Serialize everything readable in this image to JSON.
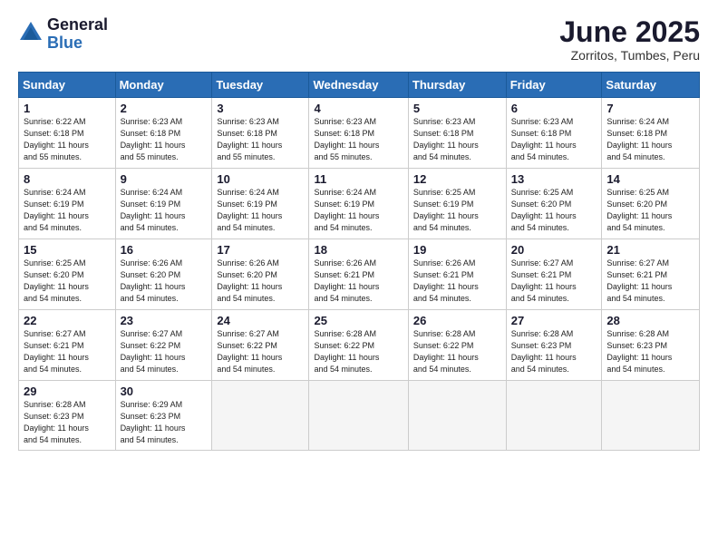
{
  "logo": {
    "general": "General",
    "blue": "Blue"
  },
  "header": {
    "month": "June 2025",
    "location": "Zorritos, Tumbes, Peru"
  },
  "weekdays": [
    "Sunday",
    "Monday",
    "Tuesday",
    "Wednesday",
    "Thursday",
    "Friday",
    "Saturday"
  ],
  "weeks": [
    [
      {
        "day": "1",
        "info": "Sunrise: 6:22 AM\nSunset: 6:18 PM\nDaylight: 11 hours\nand 55 minutes."
      },
      {
        "day": "2",
        "info": "Sunrise: 6:23 AM\nSunset: 6:18 PM\nDaylight: 11 hours\nand 55 minutes."
      },
      {
        "day": "3",
        "info": "Sunrise: 6:23 AM\nSunset: 6:18 PM\nDaylight: 11 hours\nand 55 minutes."
      },
      {
        "day": "4",
        "info": "Sunrise: 6:23 AM\nSunset: 6:18 PM\nDaylight: 11 hours\nand 55 minutes."
      },
      {
        "day": "5",
        "info": "Sunrise: 6:23 AM\nSunset: 6:18 PM\nDaylight: 11 hours\nand 54 minutes."
      },
      {
        "day": "6",
        "info": "Sunrise: 6:23 AM\nSunset: 6:18 PM\nDaylight: 11 hours\nand 54 minutes."
      },
      {
        "day": "7",
        "info": "Sunrise: 6:24 AM\nSunset: 6:18 PM\nDaylight: 11 hours\nand 54 minutes."
      }
    ],
    [
      {
        "day": "8",
        "info": "Sunrise: 6:24 AM\nSunset: 6:19 PM\nDaylight: 11 hours\nand 54 minutes."
      },
      {
        "day": "9",
        "info": "Sunrise: 6:24 AM\nSunset: 6:19 PM\nDaylight: 11 hours\nand 54 minutes."
      },
      {
        "day": "10",
        "info": "Sunrise: 6:24 AM\nSunset: 6:19 PM\nDaylight: 11 hours\nand 54 minutes."
      },
      {
        "day": "11",
        "info": "Sunrise: 6:24 AM\nSunset: 6:19 PM\nDaylight: 11 hours\nand 54 minutes."
      },
      {
        "day": "12",
        "info": "Sunrise: 6:25 AM\nSunset: 6:19 PM\nDaylight: 11 hours\nand 54 minutes."
      },
      {
        "day": "13",
        "info": "Sunrise: 6:25 AM\nSunset: 6:20 PM\nDaylight: 11 hours\nand 54 minutes."
      },
      {
        "day": "14",
        "info": "Sunrise: 6:25 AM\nSunset: 6:20 PM\nDaylight: 11 hours\nand 54 minutes."
      }
    ],
    [
      {
        "day": "15",
        "info": "Sunrise: 6:25 AM\nSunset: 6:20 PM\nDaylight: 11 hours\nand 54 minutes."
      },
      {
        "day": "16",
        "info": "Sunrise: 6:26 AM\nSunset: 6:20 PM\nDaylight: 11 hours\nand 54 minutes."
      },
      {
        "day": "17",
        "info": "Sunrise: 6:26 AM\nSunset: 6:20 PM\nDaylight: 11 hours\nand 54 minutes."
      },
      {
        "day": "18",
        "info": "Sunrise: 6:26 AM\nSunset: 6:21 PM\nDaylight: 11 hours\nand 54 minutes."
      },
      {
        "day": "19",
        "info": "Sunrise: 6:26 AM\nSunset: 6:21 PM\nDaylight: 11 hours\nand 54 minutes."
      },
      {
        "day": "20",
        "info": "Sunrise: 6:27 AM\nSunset: 6:21 PM\nDaylight: 11 hours\nand 54 minutes."
      },
      {
        "day": "21",
        "info": "Sunrise: 6:27 AM\nSunset: 6:21 PM\nDaylight: 11 hours\nand 54 minutes."
      }
    ],
    [
      {
        "day": "22",
        "info": "Sunrise: 6:27 AM\nSunset: 6:21 PM\nDaylight: 11 hours\nand 54 minutes."
      },
      {
        "day": "23",
        "info": "Sunrise: 6:27 AM\nSunset: 6:22 PM\nDaylight: 11 hours\nand 54 minutes."
      },
      {
        "day": "24",
        "info": "Sunrise: 6:27 AM\nSunset: 6:22 PM\nDaylight: 11 hours\nand 54 minutes."
      },
      {
        "day": "25",
        "info": "Sunrise: 6:28 AM\nSunset: 6:22 PM\nDaylight: 11 hours\nand 54 minutes."
      },
      {
        "day": "26",
        "info": "Sunrise: 6:28 AM\nSunset: 6:22 PM\nDaylight: 11 hours\nand 54 minutes."
      },
      {
        "day": "27",
        "info": "Sunrise: 6:28 AM\nSunset: 6:23 PM\nDaylight: 11 hours\nand 54 minutes."
      },
      {
        "day": "28",
        "info": "Sunrise: 6:28 AM\nSunset: 6:23 PM\nDaylight: 11 hours\nand 54 minutes."
      }
    ],
    [
      {
        "day": "29",
        "info": "Sunrise: 6:28 AM\nSunset: 6:23 PM\nDaylight: 11 hours\nand 54 minutes."
      },
      {
        "day": "30",
        "info": "Sunrise: 6:29 AM\nSunset: 6:23 PM\nDaylight: 11 hours\nand 54 minutes."
      },
      {
        "day": "",
        "info": ""
      },
      {
        "day": "",
        "info": ""
      },
      {
        "day": "",
        "info": ""
      },
      {
        "day": "",
        "info": ""
      },
      {
        "day": "",
        "info": ""
      }
    ]
  ]
}
